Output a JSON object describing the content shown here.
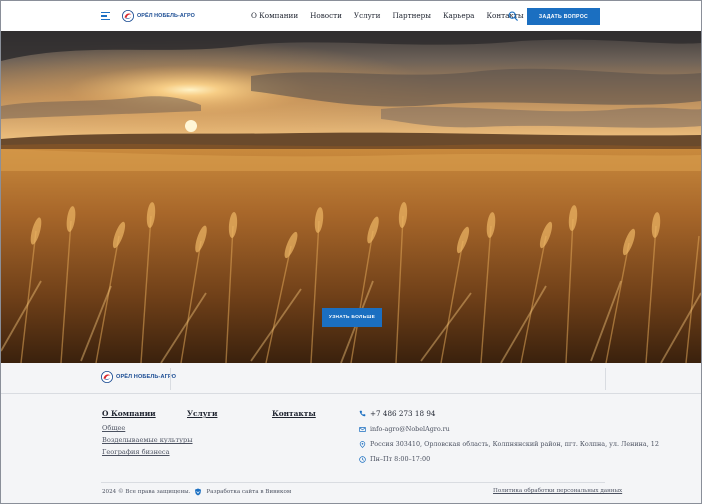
{
  "header": {
    "logo_text": "ОРЁЛ НОБЕЛЬ-АГРО",
    "nav": [
      "О Компании",
      "Новости",
      "Услуги",
      "Партнеры",
      "Карьера",
      "Контакты"
    ],
    "ask_button": "Задать вопрос"
  },
  "hero": {
    "more_button": "Узнать больше"
  },
  "footer": {
    "logo_text": "ОРЁЛ НОБЕЛЬ-АГРО",
    "columns": [
      {
        "title": "О Компании",
        "links": [
          "Общее",
          "Возделываемые культуры",
          "География бизнеса"
        ]
      },
      {
        "title": "Услуги",
        "links": []
      },
      {
        "title": "Контакты",
        "links": []
      }
    ],
    "contacts": {
      "phone": "+7 486 273 18 94",
      "email": "info-agro@NobelAgro.ru",
      "address": "Россия 303410, Орловская область, Колпнянский район, пгт. Колпна, ул. Ленина, 12",
      "hours": "Пн–Пт 8:00–17:00"
    },
    "copyright": "2024 © Все права защищены.",
    "developer": "Разработка сайта в Вивиком",
    "policy": "Политика обработки персональных данных"
  },
  "colors": {
    "accent": "#1b6fc1",
    "brand": "#1a4c93"
  }
}
